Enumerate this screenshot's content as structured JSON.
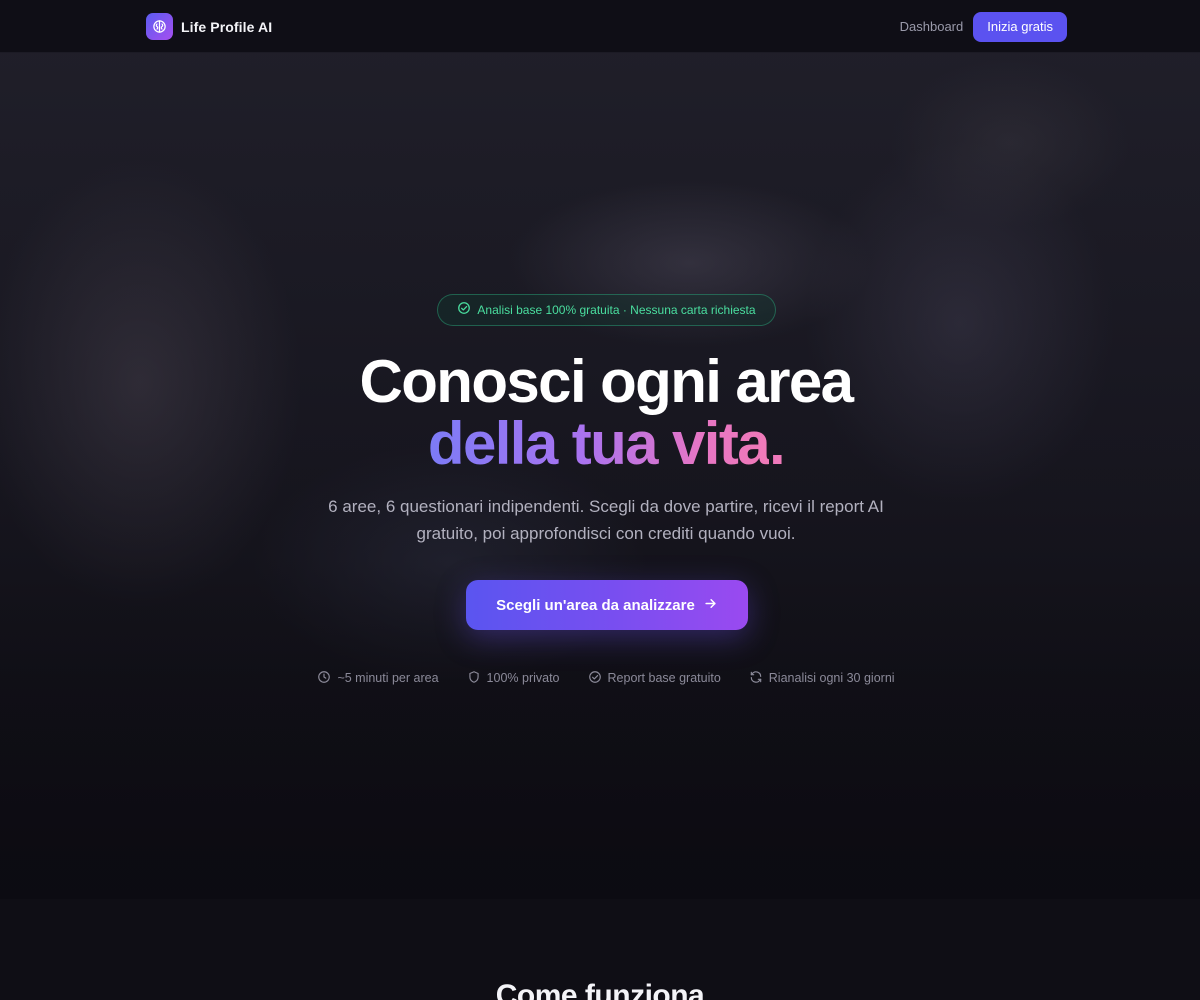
{
  "nav": {
    "brand": "Life Profile AI",
    "dashboard_link": "Dashboard",
    "cta_label": "Inizia gratis"
  },
  "hero": {
    "badge": "Analisi base 100% gratuita · Nessuna carta richiesta",
    "headline_line1": "Conosci ogni area",
    "headline_line2": "della tua vita",
    "headline_punct": ".",
    "subtitle": "6 aree, 6 questionari indipendenti. Scegli da dove partire, ricevi il report AI gratuito, poi approfondisci con crediti quando vuoi.",
    "cta_label": "Scegli un'area da analizzare",
    "features": [
      {
        "icon": "clock-icon",
        "label": "~5 minuti per area"
      },
      {
        "icon": "shield-icon",
        "label": "100% privato"
      },
      {
        "icon": "check-circle-icon",
        "label": "Report base gratuito"
      },
      {
        "icon": "refresh-icon",
        "label": "Rianalisi ogni 30 giorni"
      }
    ]
  },
  "section_two": {
    "title": "Come funziona"
  },
  "colors": {
    "accent": "#5b52f0",
    "badge_green": "#4ade9f",
    "gradient_start": "#7c7bf6",
    "gradient_end": "#f07ab8"
  }
}
